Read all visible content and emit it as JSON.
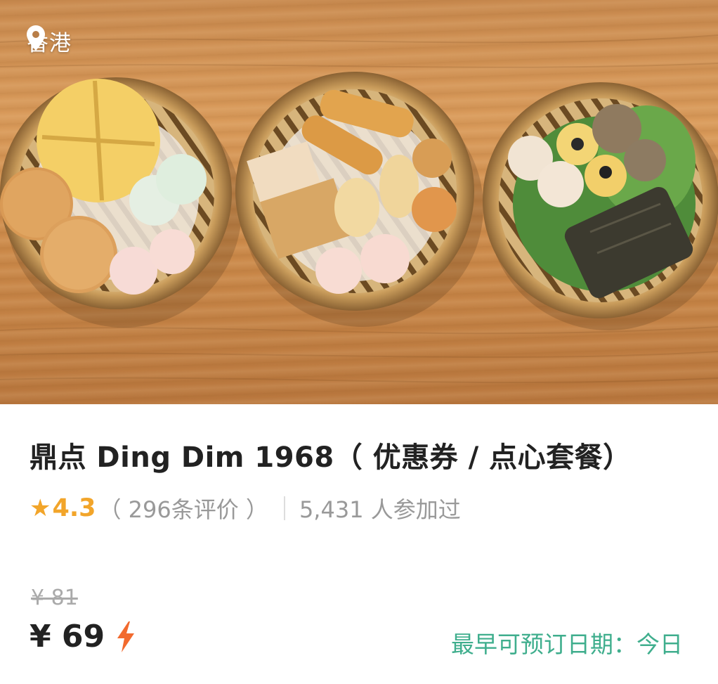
{
  "hero": {
    "location": "香港",
    "location_icon": "map-pin-icon",
    "image_subject": "dim-sum-steamers-photo"
  },
  "product": {
    "title": "鼎点 Ding Dim 1968（ 优惠券 / 点心套餐）",
    "rating": {
      "star_icon": "★",
      "score": "4.3",
      "reviews": "（ 296条评价 ）",
      "participants": "5,431 人参加过"
    },
    "original_price": "¥ 81",
    "price": "¥ 69",
    "flash_icon": "lightning-icon",
    "earliest_booking": "最早可预订日期：今日"
  },
  "colors": {
    "accent_star": "#f2a52a",
    "booking_green": "#3fae8d",
    "flash_orange": "#f26a2e"
  }
}
